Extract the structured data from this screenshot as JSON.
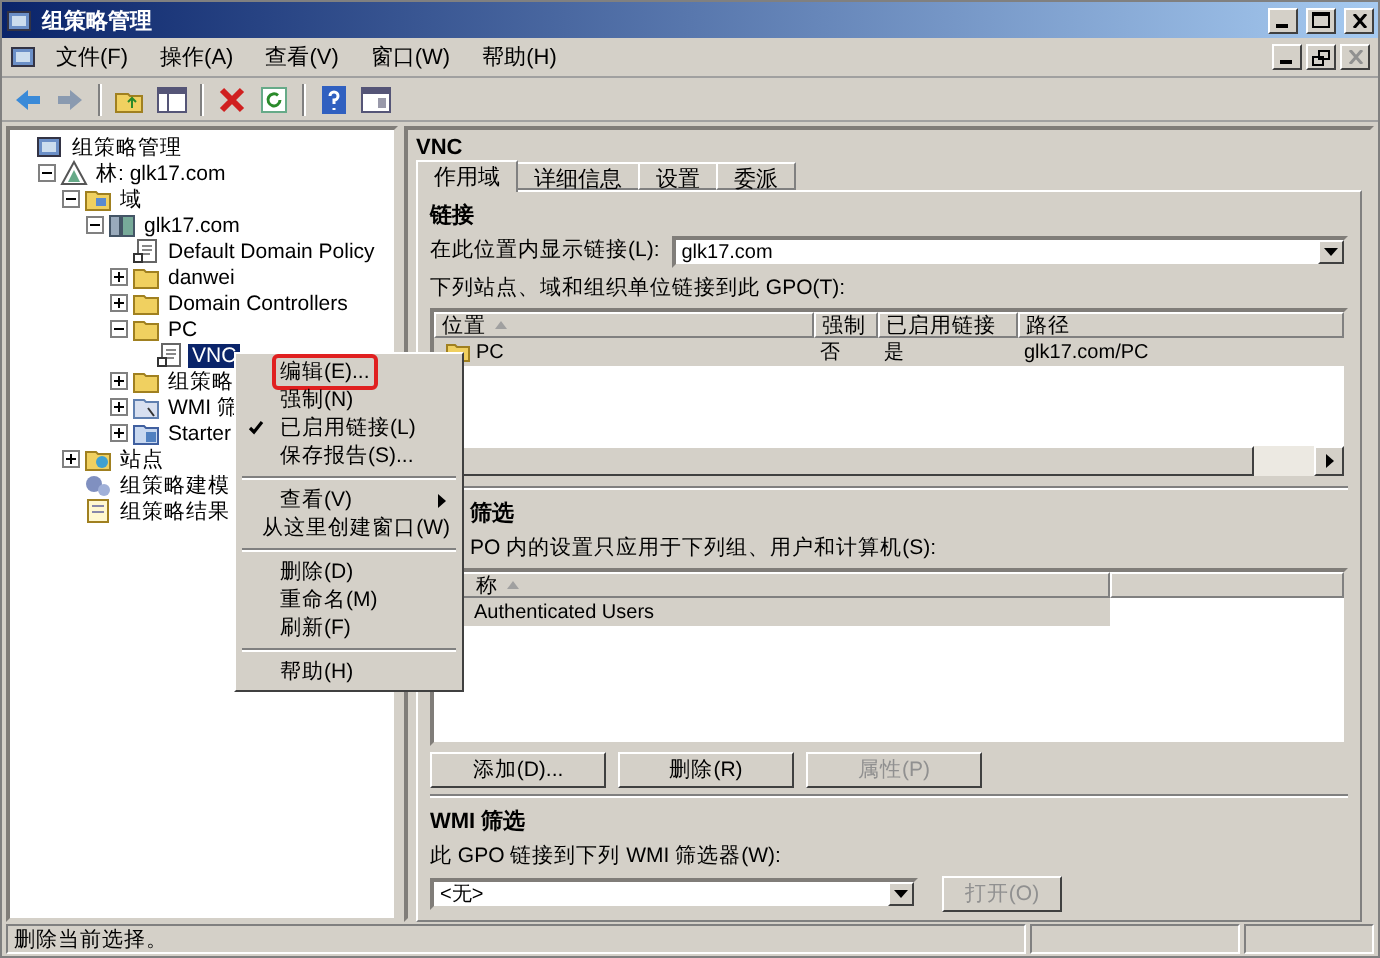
{
  "window": {
    "title": "组策略管理"
  },
  "menu_bar": [
    {
      "label": "文件(F)"
    },
    {
      "label": "操作(A)"
    },
    {
      "label": "查看(V)"
    },
    {
      "label": "窗口(W)"
    },
    {
      "label": "帮助(H)"
    }
  ],
  "toolbar": [
    {
      "kind": "back"
    },
    {
      "kind": "forward"
    },
    {
      "kind": "separator"
    },
    {
      "kind": "up"
    },
    {
      "kind": "tree"
    },
    {
      "kind": "separator"
    },
    {
      "kind": "delete"
    },
    {
      "kind": "refresh"
    },
    {
      "kind": "separator"
    },
    {
      "kind": "help"
    },
    {
      "kind": "console"
    }
  ],
  "tree": [
    {
      "kind": "root",
      "label": "组策略管理",
      "children": [
        {
          "kind": "forest",
          "label": "林: glk17.com",
          "expanded": true,
          "children": [
            {
              "kind": "domains",
              "label": "域",
              "expanded": true,
              "children": [
                {
                  "kind": "domain",
                  "label": "glk17.com",
                  "expanded": true,
                  "children": [
                    {
                      "kind": "gpo",
                      "label": "Default Domain Policy",
                      "selected": false
                    },
                    {
                      "kind": "ou",
                      "label": "danwei",
                      "expanded": false
                    },
                    {
                      "kind": "ou",
                      "label": "Domain Controllers",
                      "expanded": false
                    },
                    {
                      "kind": "ou",
                      "label": "PC",
                      "expanded": true,
                      "children": [
                        {
                          "kind": "gpo",
                          "label": "VNC",
                          "selected": true
                        }
                      ]
                    },
                    {
                      "kind": "folder",
                      "label": "组策略",
                      "expanded": false
                    },
                    {
                      "kind": "wmi",
                      "label": "WMI 筛",
                      "expanded": false
                    },
                    {
                      "kind": "starter",
                      "label": "Starter",
                      "expanded": false
                    }
                  ]
                }
              ]
            },
            {
              "kind": "sites",
              "label": "站点",
              "expanded": false
            },
            {
              "kind": "modeling",
              "label": "组策略建模"
            },
            {
              "kind": "results",
              "label": "组策略结果"
            }
          ]
        }
      ]
    }
  ],
  "details": {
    "title": "VNC",
    "tabs": [
      {
        "label": "作用域",
        "selected": true
      },
      {
        "label": "详细信息",
        "selected": false
      },
      {
        "label": "设置",
        "selected": false
      },
      {
        "label": "委派",
        "selected": false
      }
    ],
    "links": {
      "heading": "链接",
      "location_label": "在此位置内显示链接(L):",
      "location_value": "glk17.com",
      "list_label": "下列站点、域和组织单位链接到此 GPO(T):",
      "columns": [
        "位置",
        "强制",
        "已启用链接",
        "路径"
      ],
      "rows": [
        {
          "cells": [
            "PC",
            "否",
            "是",
            "glk17.com/PC"
          ],
          "selected": true
        }
      ]
    },
    "security_filtering": {
      "heading": "筛选",
      "label": "PO 内的设置只应用于下列组、用户和计算机(S):",
      "columns": [
        "称"
      ],
      "rows": [
        {
          "label": "Authenticated Users",
          "selected": true
        }
      ],
      "buttons": [
        {
          "label": "添加(D)...",
          "disabled": false
        },
        {
          "label": "删除(R)",
          "disabled": false
        },
        {
          "label": "属性(P)",
          "disabled": true
        }
      ]
    },
    "wmi_filtering": {
      "heading": "WMI 筛选",
      "label": "此 GPO 链接到下列 WMI 筛选器(W):",
      "value": "<无>",
      "button": {
        "label": "打开(O)",
        "disabled": true
      }
    }
  },
  "context_menu": [
    {
      "kind": "item",
      "label": "编辑(E)...",
      "checked": false,
      "highlighted": true,
      "submenu": false
    },
    {
      "kind": "item",
      "label": "强制(N)",
      "checked": false,
      "highlighted": false,
      "submenu": false
    },
    {
      "kind": "item",
      "label": "已启用链接(L)",
      "checked": true,
      "highlighted": false,
      "submenu": false
    },
    {
      "kind": "item",
      "label": "保存报告(S)...",
      "checked": false,
      "highlighted": false,
      "submenu": false
    },
    {
      "kind": "separator"
    },
    {
      "kind": "item",
      "label": "查看(V)",
      "checked": false,
      "highlighted": false,
      "submenu": true
    },
    {
      "kind": "item",
      "label": "从这里创建窗口(W)",
      "checked": false,
      "highlighted": false,
      "submenu": false
    },
    {
      "kind": "separator"
    },
    {
      "kind": "item",
      "label": "删除(D)",
      "checked": false,
      "highlighted": false,
      "submenu": false
    },
    {
      "kind": "item",
      "label": "重命名(M)",
      "checked": false,
      "highlighted": false,
      "submenu": false
    },
    {
      "kind": "item",
      "label": "刷新(F)",
      "checked": false,
      "highlighted": false,
      "submenu": false
    },
    {
      "kind": "separator"
    },
    {
      "kind": "item",
      "label": "帮助(H)",
      "checked": false,
      "highlighted": false,
      "submenu": false
    }
  ],
  "status_bar": {
    "text": "删除当前选择。"
  }
}
